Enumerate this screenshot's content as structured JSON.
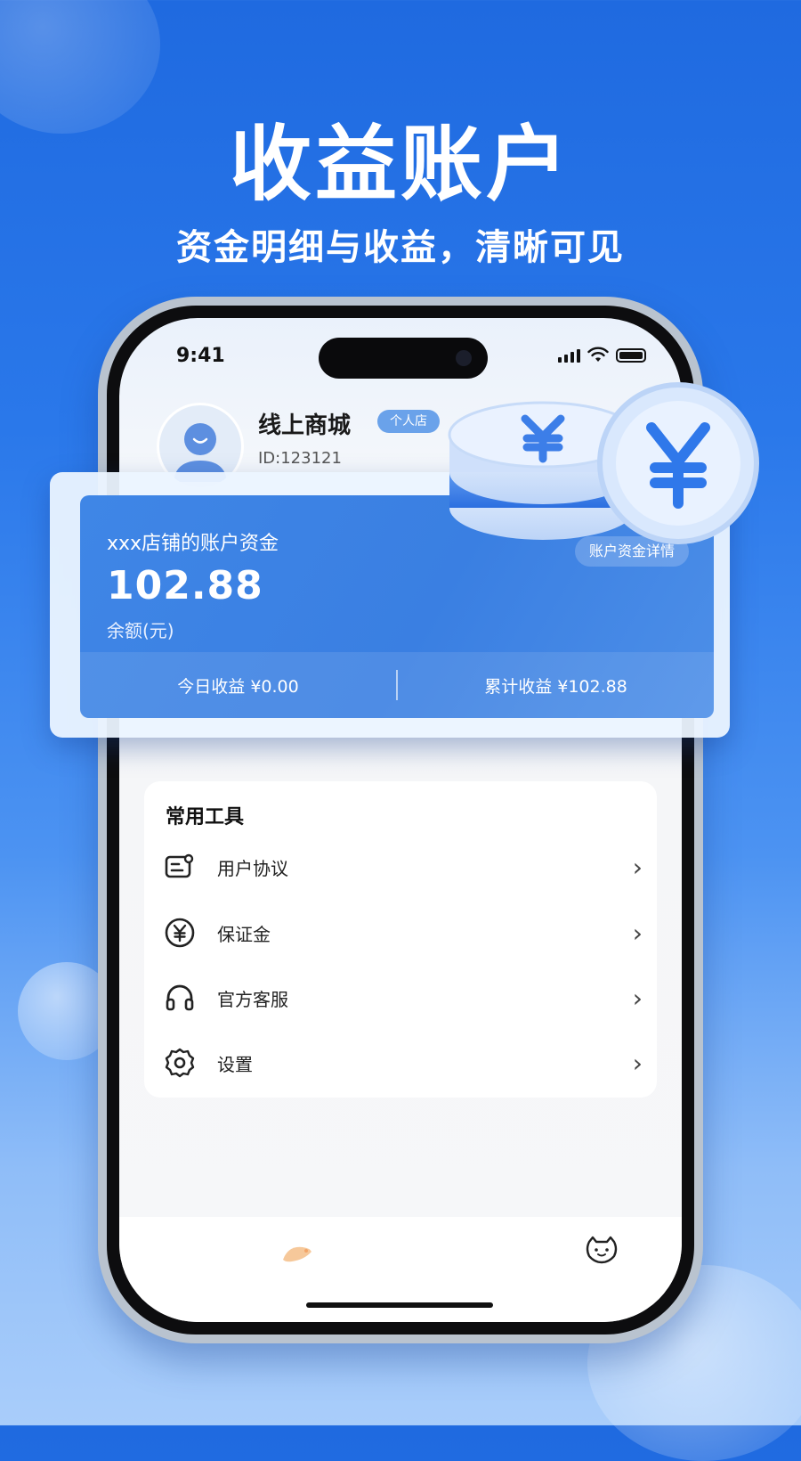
{
  "hero": {
    "title": "收益账户",
    "subtitle": "资金明细与收益，清晰可见"
  },
  "status_bar": {
    "time": "9:41"
  },
  "profile": {
    "store_name": "线上商城",
    "store_type": "个人店",
    "store_id": "ID:123121"
  },
  "balance_card": {
    "title": "xxx店铺的账户资金",
    "amount": "102.88",
    "amount_label": "余额(元)",
    "detail_button": "账户资金详情",
    "today_income": "今日收益 ¥0.00",
    "total_income": "累计收益 ¥102.88"
  },
  "tools": {
    "title": "常用工具",
    "items": [
      {
        "label": "用户协议",
        "icon": "agreement-icon"
      },
      {
        "label": "保证金",
        "icon": "yuan-circle-icon"
      },
      {
        "label": "官方客服",
        "icon": "headset-icon"
      },
      {
        "label": "设置",
        "icon": "gear-icon"
      }
    ]
  },
  "colors": {
    "brand_blue": "#2a78ea",
    "card_blue": "#3f86e6",
    "tag_blue": "#6aa2ea"
  }
}
